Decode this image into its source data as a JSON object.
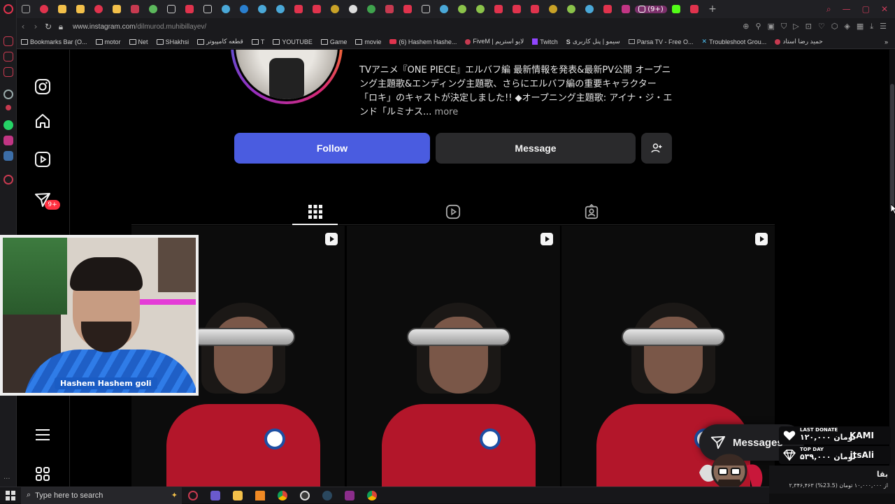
{
  "browser": {
    "url_host": "www.instagram.com",
    "url_path": "/dilmurod.muhibillayev/",
    "active_tab_badge": "(9+)",
    "bookmarks": [
      {
        "label": "Bookmarks Bar (O...",
        "icon": "folder-icon"
      },
      {
        "label": "motor",
        "icon": "folder-icon"
      },
      {
        "label": "Net",
        "icon": "folder-icon"
      },
      {
        "label": "SHakhsi",
        "icon": "folder-icon"
      },
      {
        "label": "قطعه کامپیوتر",
        "icon": "folder-icon"
      },
      {
        "label": "T",
        "icon": "folder-icon"
      },
      {
        "label": "YOUTUBE",
        "icon": "folder-icon"
      },
      {
        "label": "Game",
        "icon": "folder-icon"
      },
      {
        "label": "movie",
        "icon": "folder-icon"
      },
      {
        "label": "(6) Hashem Hashe...",
        "icon": "youtube-icon"
      },
      {
        "label": "FiveM | لایو استریم",
        "icon": "site-icon"
      },
      {
        "label": "Twitch",
        "icon": "twitch-icon"
      },
      {
        "label": "سیمو | پنل کاربری",
        "icon": "site-icon"
      },
      {
        "label": "Parsa TV - Free O...",
        "icon": "site-icon"
      },
      {
        "label": "Troubleshoot Grou...",
        "icon": "site-icon"
      },
      {
        "label": "حمید رضا استاد",
        "icon": "site-icon"
      }
    ]
  },
  "profile": {
    "bio": "TVアニメ『ONE PIECE』エルバフ編 最新情報を発表&最新PV公開 オープニング主題歌&エンディング主題歌、さらにエルバフ編の重要キャラクター「ロキ」のキャストが決定しました!! ◆オープニング主題歌: アイナ・ジ・エンド「ルミナス...",
    "more_label": "more",
    "follow_label": "Follow",
    "message_label": "Message"
  },
  "nav": {
    "notifications_badge": "9+"
  },
  "messages_pill": {
    "label": "Messages"
  },
  "webcam": {
    "name_tag": "Hashem Hashem goli"
  },
  "donations": {
    "last_label": "LAST DONATE",
    "last_amount": "۱۲۰,۰۰۰ تومان",
    "last_name": "KAMI",
    "top_label": "TOP DAY",
    "top_amount": "۵۳۹,۰۰۰ تومان",
    "top_name": "itsAli",
    "goal_title": "بقا",
    "goal_text": "۲,۳۴۶,۴۶۳ از ۱۰,۰۰۰,۰۰۰ تومان (23.5%)"
  },
  "taskbar": {
    "search_placeholder": "Type here to search"
  },
  "colors": {
    "follow_button": "#4a5ce0",
    "badge_red": "#ff3040",
    "page_bg": "#000000"
  }
}
